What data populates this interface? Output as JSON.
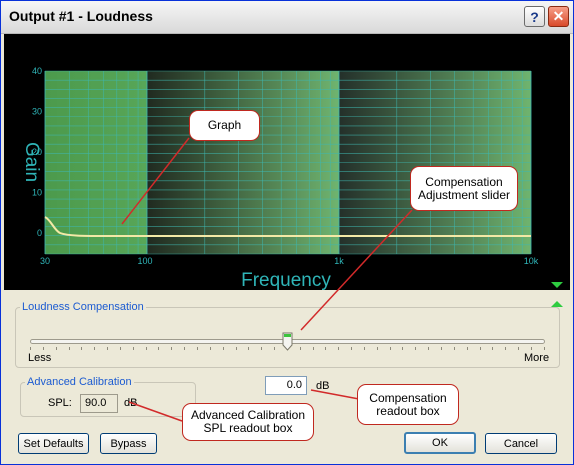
{
  "window": {
    "title": "Output #1 - Loudness",
    "help_glyph": "?",
    "close_glyph": "✕"
  },
  "graph": {
    "y_axis_label": "Gain",
    "x_axis_label": "Frequency",
    "y_ticks": [
      "40",
      "30",
      "20",
      "10",
      "0"
    ],
    "x_ticks": [
      "30",
      "100",
      "1k",
      "10k"
    ],
    "curve_color": "#f3e9a6",
    "grid_color": "#3fb7b0",
    "axis_text_color": "#2fb5b8"
  },
  "loudness": {
    "group_label": "Loudness Compensation",
    "min_label": "Less",
    "max_label": "More",
    "slider_value_fraction": 0.5,
    "readout_value": "0.0",
    "readout_unit": "dB"
  },
  "calibration": {
    "group_label": "Advanced Calibration",
    "spl_label": "SPL:",
    "spl_value": "90.0",
    "spl_unit": "dB"
  },
  "buttons": {
    "set_defaults": "Set Defaults",
    "bypass": "Bypass",
    "ok": "OK",
    "cancel": "Cancel"
  },
  "callouts": {
    "graph": "Graph",
    "slider_line1": "Compensation",
    "slider_line2": "Adjustment slider",
    "readout_line1": "Compensation",
    "readout_line2": "readout box",
    "spl_line1": "Advanced Calibration",
    "spl_line2": "SPL readout box"
  }
}
